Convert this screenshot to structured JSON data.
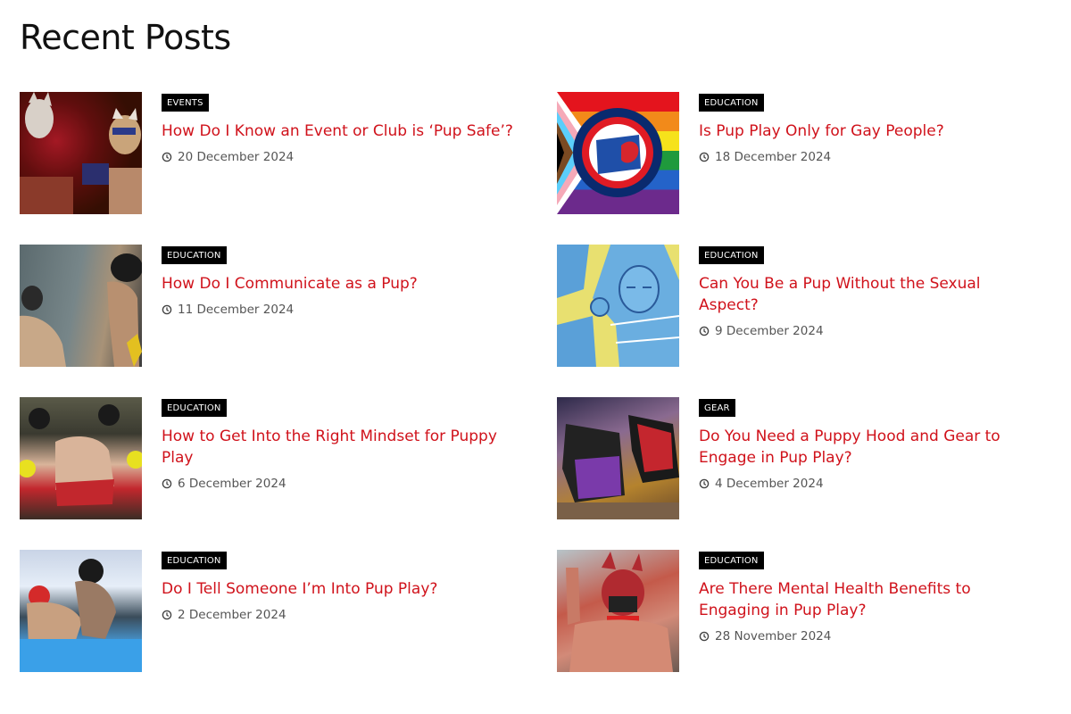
{
  "section": {
    "title": "Recent Posts"
  },
  "posts": [
    {
      "category": "EVENTS",
      "title": "How Do I Know an Event or Club is ‘Pup Safe’?",
      "date": "20 December 2024"
    },
    {
      "category": "EDUCATION",
      "title": "Is Pup Play Only for Gay People?",
      "date": "18 December 2024"
    },
    {
      "category": "EDUCATION",
      "title": "How Do I Communicate as a Pup?",
      "date": "11 December 2024"
    },
    {
      "category": "EDUCATION",
      "title": "Can You Be a Pup Without the Sexual Aspect?",
      "date": "9 December 2024"
    },
    {
      "category": "EDUCATION",
      "title": "How to Get Into the Right Mindset for Puppy Play",
      "date": "6 December 2024"
    },
    {
      "category": "GEAR",
      "title": "Do You Need a Puppy Hood and Gear to Engage in Pup Play?",
      "date": "4 December 2024"
    },
    {
      "category": "EDUCATION",
      "title": "Do I Tell Someone I’m Into Pup Play?",
      "date": "2 December 2024"
    },
    {
      "category": "EDUCATION",
      "title": "Are There Mental Health Benefits to Engaging in Pup Play?",
      "date": "28 November 2024"
    }
  ],
  "colors": {
    "title_link": "#d0121b",
    "category_bg": "#000000",
    "date_text": "#555555"
  },
  "icons": {
    "date": "clock-icon"
  }
}
